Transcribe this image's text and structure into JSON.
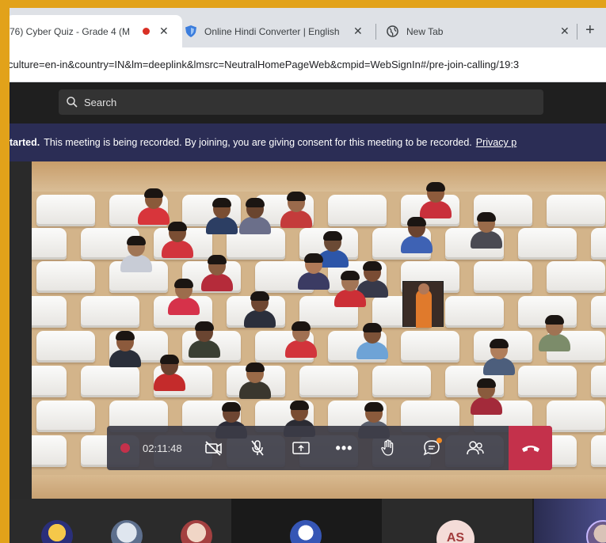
{
  "browser": {
    "tabs": [
      {
        "title": "76) Cyber Quiz - Grade 4 (M",
        "recording": true,
        "active": true
      },
      {
        "title": "Online Hindi Converter | English",
        "icon": "shield-icon"
      },
      {
        "title": "New Tab",
        "icon": "globe-icon"
      }
    ],
    "close_glyph": "✕",
    "new_tab_glyph": "+",
    "url": "culture=en-in&country=IN&lm=deeplink&lmsrc=NeutralHomePageWeb&cmpid=WebSignIn#/pre-join-calling/19:3"
  },
  "teams": {
    "search_placeholder": "Search",
    "banner": {
      "bold": "tarted.",
      "text": "This meeting is being recorded. By joining, you are giving consent for this meeting to be recorded.",
      "link": "Privacy p"
    }
  },
  "controls": {
    "timer": "02:11:48",
    "more_glyph": "•••",
    "items": [
      "camera-off",
      "mic-muted",
      "share-screen",
      "more-options",
      "raise-hand",
      "chat",
      "participants",
      "hang-up"
    ]
  },
  "gallery": {
    "initials": "AS"
  },
  "colors": {
    "frame": "#e2a21a",
    "banner": "#2b2d55",
    "hangup": "#c4314b",
    "controls": "#3c3c46"
  }
}
